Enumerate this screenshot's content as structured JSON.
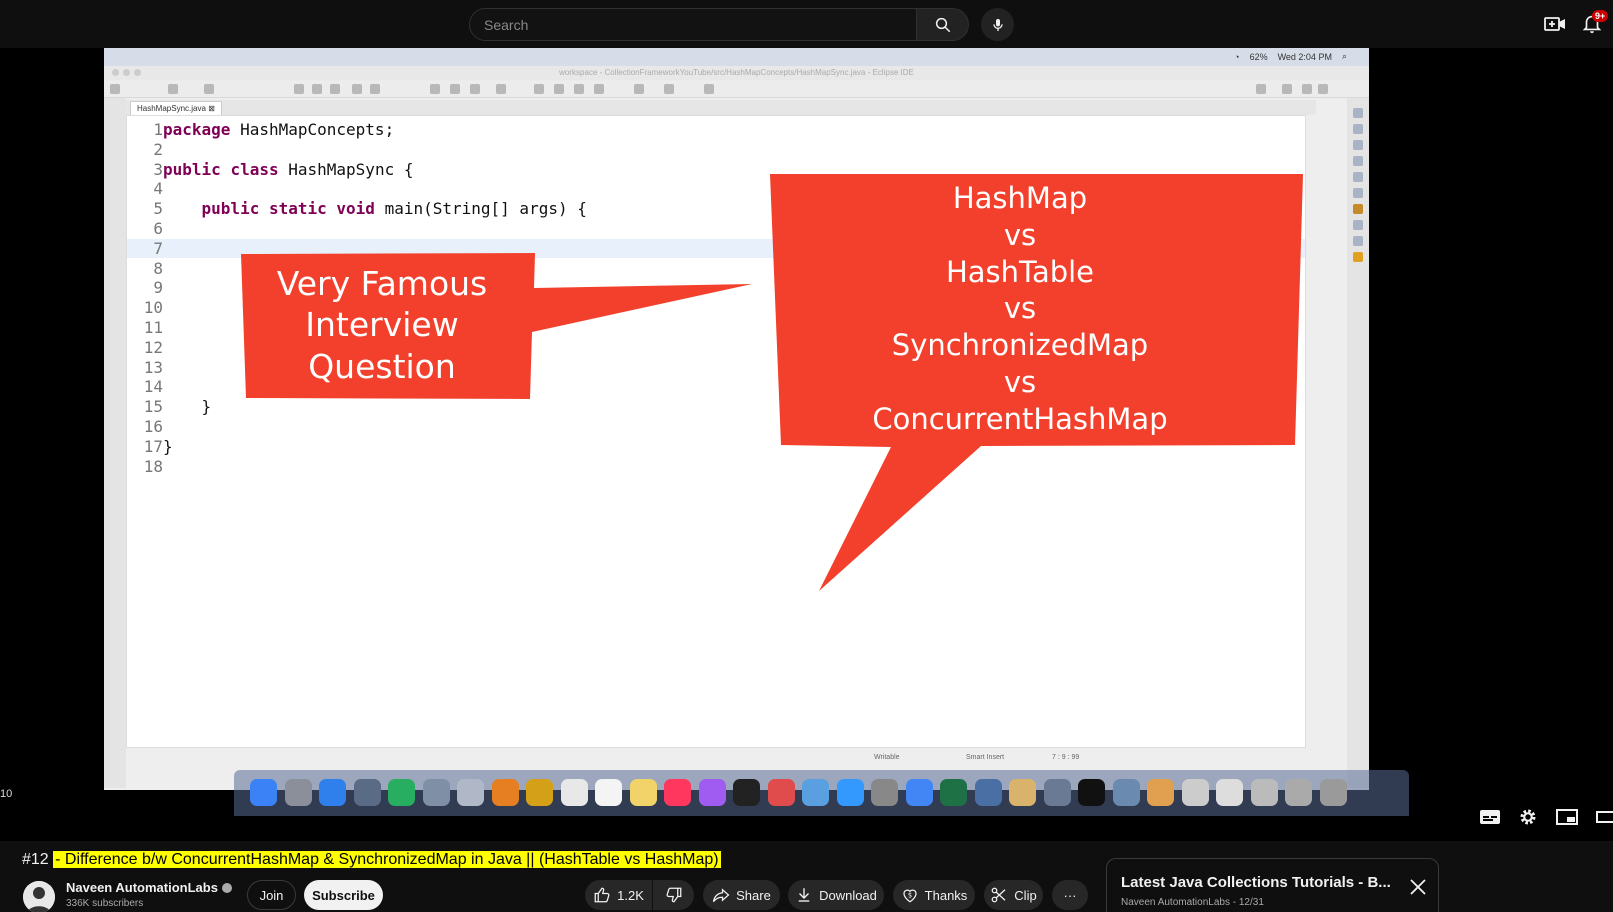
{
  "topbar": {
    "search_placeholder": "Search",
    "notification_count": "9+"
  },
  "video": {
    "mac_menubar": {
      "battery": "62%",
      "clock": "Wed 2:04 PM"
    },
    "ide_title": "workspace - CollectionFrameworkYouTube/src/HashMapConcepts/HashMapSync.java - Eclipse IDE",
    "editor_tab": "HashMapSync.java",
    "code_lines": [
      {
        "n": "1",
        "text": "package HashMapConcepts;"
      },
      {
        "n": "2",
        "text": ""
      },
      {
        "n": "3",
        "text": "public class HashMapSync {"
      },
      {
        "n": "4",
        "text": ""
      },
      {
        "n": "5",
        "text": "    public static void main(String[] args) {"
      },
      {
        "n": "6",
        "text": ""
      },
      {
        "n": "7",
        "text": ""
      },
      {
        "n": "8",
        "text": ""
      },
      {
        "n": "9",
        "text": ""
      },
      {
        "n": "10",
        "text": ""
      },
      {
        "n": "11",
        "text": ""
      },
      {
        "n": "12",
        "text": ""
      },
      {
        "n": "13",
        "text": ""
      },
      {
        "n": "14",
        "text": ""
      },
      {
        "n": "15",
        "text": "    }"
      },
      {
        "n": "16",
        "text": ""
      },
      {
        "n": "17",
        "text": "}"
      },
      {
        "n": "18",
        "text": ""
      }
    ],
    "status": {
      "writable": "Writable",
      "insert_mode": "Smart Insert",
      "position": "7 : 9 : 99"
    },
    "callout_left": [
      "Very Famous",
      "Interview",
      "Question"
    ],
    "callout_right": [
      "HashMap",
      "vs",
      "HashTable",
      "vs",
      "SynchronizedMap",
      "vs",
      "ConcurrentHashMap"
    ],
    "time_fragment": "10",
    "colors": {
      "callout_red": "#f2402c",
      "keyword": "#7f0055"
    }
  },
  "info": {
    "title_prefix": "#12 ",
    "title_highlight": "- Difference b/w ConcurrentHashMap & SynchronizedMap in Java || (HashTable vs HashMap)",
    "channel_name": "Naveen AutomationLabs",
    "subscribers": "336K subscribers",
    "join_label": "Join",
    "subscribe_label": "Subscribe",
    "like_count": "1.2K",
    "share_label": "Share",
    "download_label": "Download",
    "thanks_label": "Thanks",
    "clip_label": "Clip",
    "more_label": "···"
  },
  "playlist": {
    "title": "Latest Java Collections Tutorials - B...",
    "subtitle": "Naveen AutomationLabs - 12/31"
  }
}
